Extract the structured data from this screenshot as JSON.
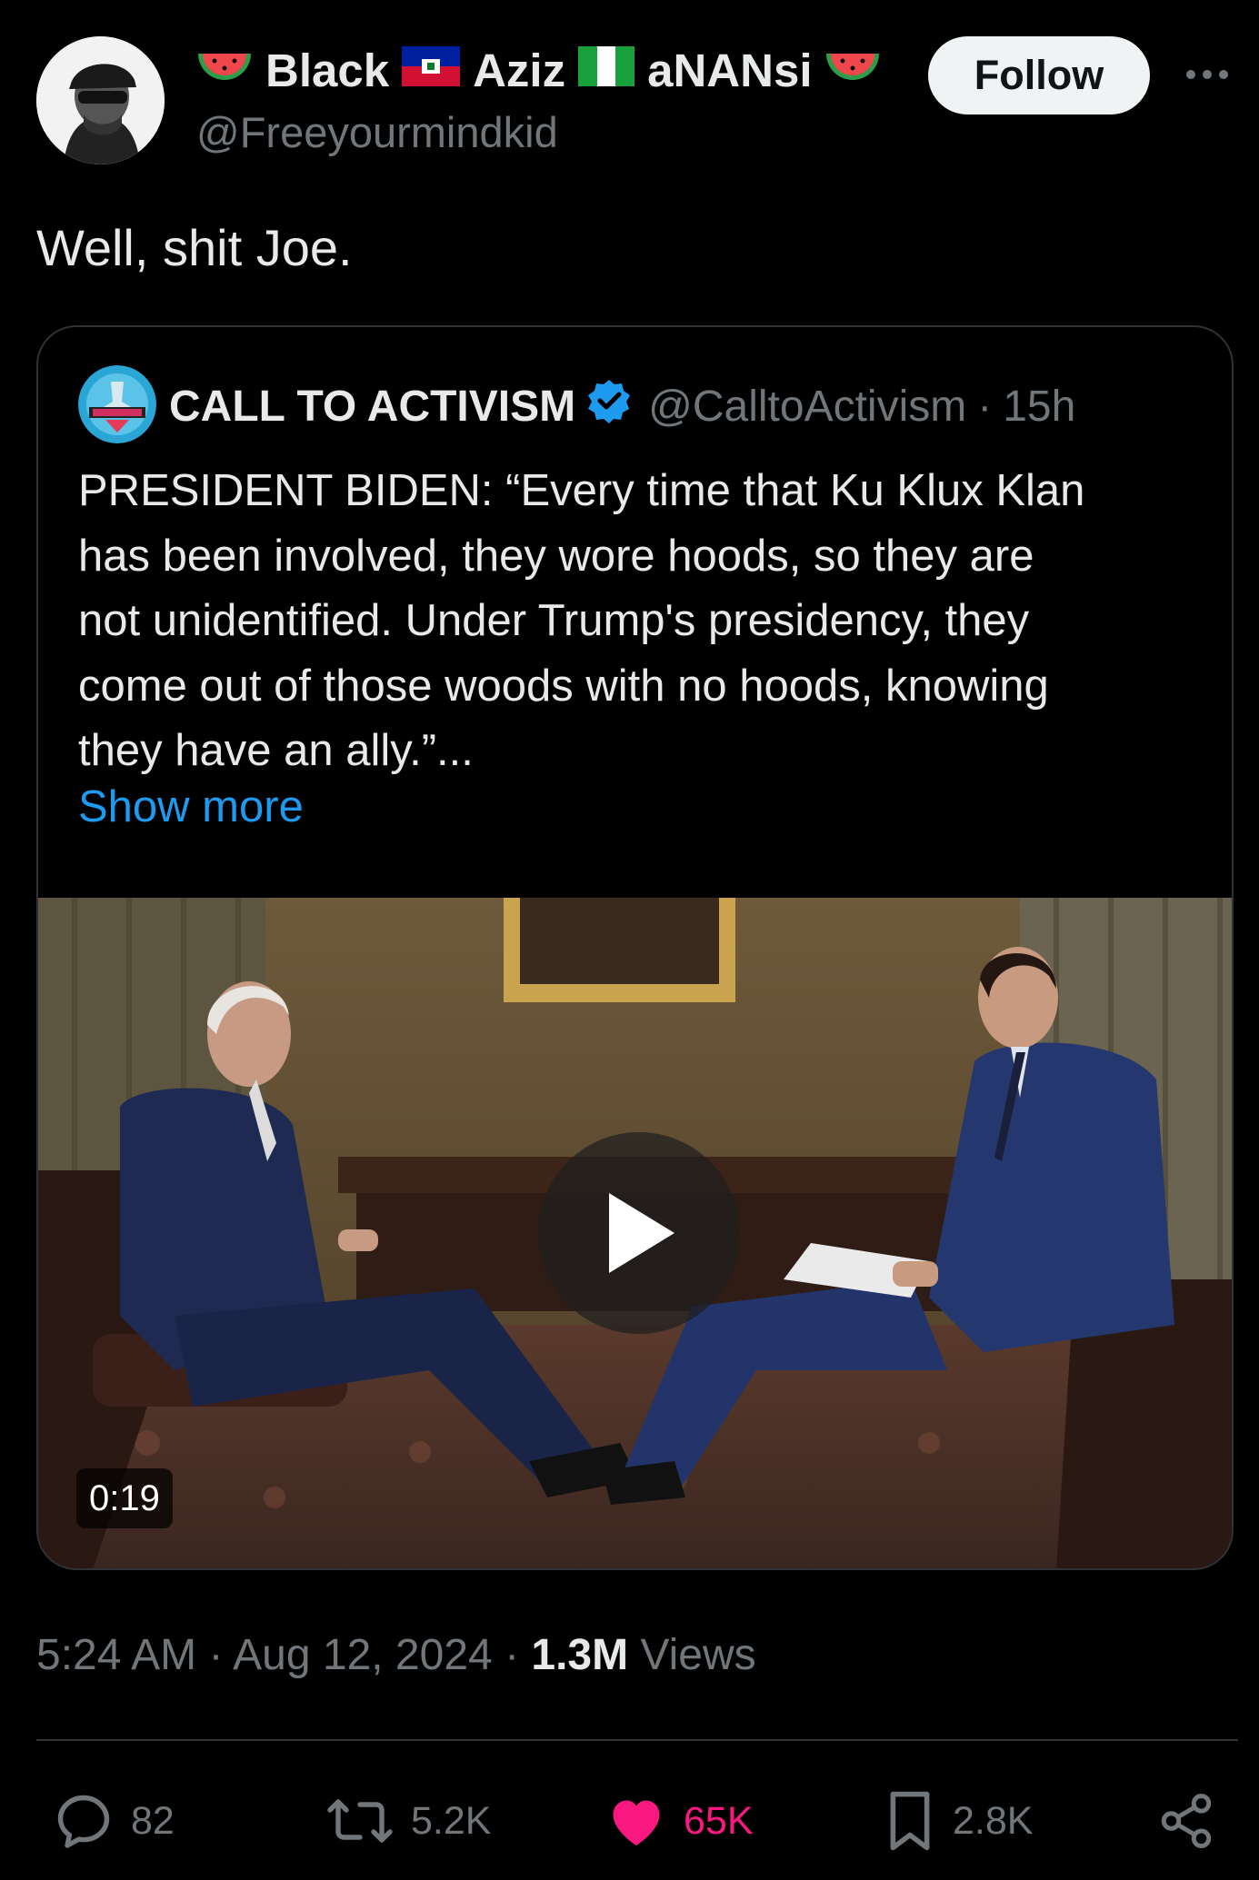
{
  "author": {
    "name_parts": [
      "Black",
      "Aziz",
      "aNANsi"
    ],
    "handle": "@Freeyourmindkid",
    "follow_label": "Follow"
  },
  "tweet": {
    "text": "Well, shit Joe."
  },
  "quote": {
    "name": "CALL TO ACTIVISM",
    "handle": "@CalltoActivism",
    "separator": "·",
    "time": "15h",
    "lines": [
      "PRESIDENT BIDEN: “Every time that Ku Klux Klan",
      "has been involved, they wore hoods, so they are",
      "not unidentified. Under Trump's presidency, they",
      "come out of those woods with no hoods, knowing",
      "they have an ally.”..."
    ],
    "show_more": "Show more",
    "video_duration": "0:19"
  },
  "meta": {
    "time": "5:24 AM",
    "sep1": "·",
    "date": "Aug 12, 2024",
    "sep2": "·",
    "views_count": "1.3M",
    "views_label": "Views"
  },
  "actions": {
    "replies": "82",
    "reposts": "5.2K",
    "likes": "65K",
    "bookmarks": "2.8K"
  },
  "colors": {
    "background": "#000000",
    "text": "#e7e9ea",
    "muted": "#71767b",
    "link": "#1d9bf0",
    "like": "#f91880",
    "verified": "#1d9bf0"
  }
}
